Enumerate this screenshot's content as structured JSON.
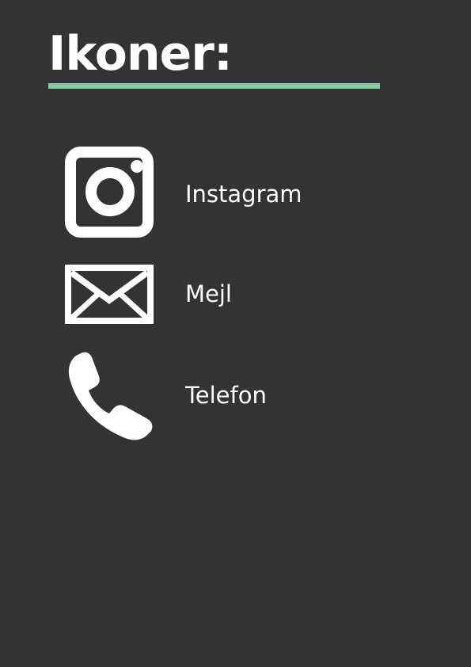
{
  "page": {
    "title": "Ikoner:",
    "accent_color": "#7BD19A",
    "background_color": "#333333",
    "text_color": "#FFFFFF"
  },
  "icons": [
    {
      "icon": "instagram-icon",
      "label": "Instagram"
    },
    {
      "icon": "mail-icon",
      "label": "Mejl"
    },
    {
      "icon": "phone-icon",
      "label": "Telefon"
    }
  ]
}
